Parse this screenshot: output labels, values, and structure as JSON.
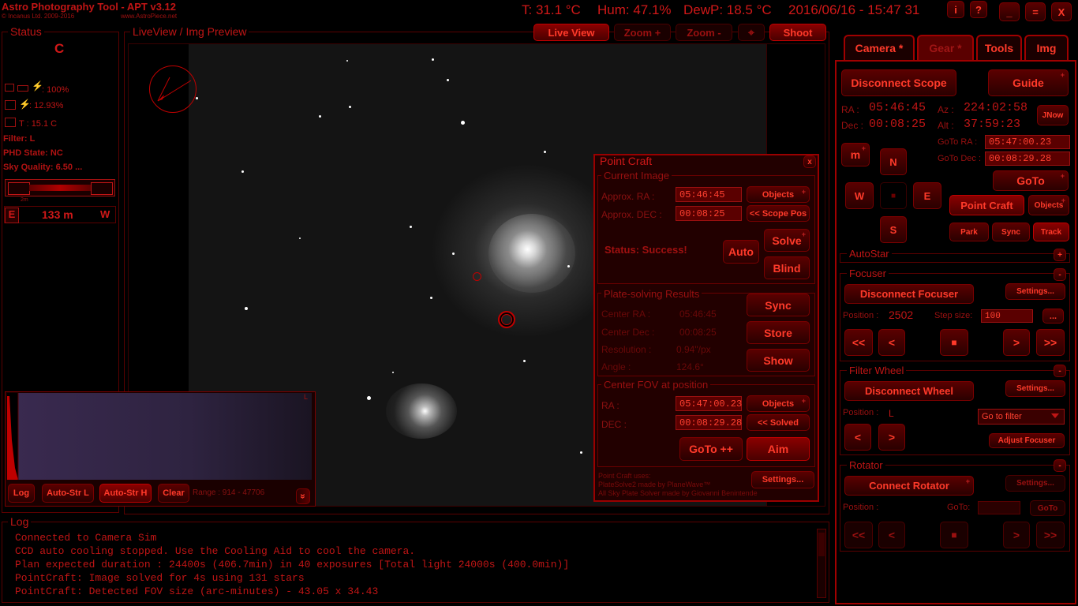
{
  "app": {
    "title": "Astro Photography Tool - APT v3.12",
    "copyright": "© Incanus Ltd. 2009-2016",
    "website": "www.AstroPiece.net"
  },
  "header": {
    "temperature": "T: 31.1 °C",
    "humidity": "Hum: 47.1%",
    "dewpoint": "DewP: 18.5 °C",
    "datetime": "2016/06/16 - 15:47 31",
    "info_label": "i",
    "help_label": "?",
    "minimize_label": "_",
    "maximize_label": "=",
    "close_label": "X"
  },
  "status": {
    "title": "Status",
    "state_letter": "C",
    "power_value": ": 100%",
    "cooler_value": ": 12.93%",
    "temp_value": "T : 15.1 C",
    "filter": "Filter: L",
    "phd_state": "PHD State: NC",
    "sky_quality": "Sky Quality: 6.50 ...",
    "focus_bar_left": "2m",
    "direction_east": "E",
    "distance": "133 m",
    "direction_west": "W"
  },
  "liveview": {
    "title": "LiveView / Img Preview",
    "live_view_btn": "Live View",
    "zoom_in_btn": "Zoom +",
    "zoom_out_btn": "Zoom -",
    "crosshair_btn": "⌖",
    "shoot_btn": "Shoot"
  },
  "histogram": {
    "corner_label": "L",
    "log_btn": "Log",
    "autostr_l_btn": "Auto-Str L",
    "autostr_h_btn": "Auto-Str H",
    "clear_btn": "Clear",
    "range": "Range : 914 - 47706",
    "expand_icon": "»"
  },
  "pointcraft": {
    "title": "Point Craft",
    "close_label": "x",
    "current_image_title": "Current Image",
    "approx_ra_label": "Approx. RA :",
    "approx_ra_value": "05:46:45",
    "approx_dec_label": "Approx. DEC :",
    "approx_dec_value": "00:08:25",
    "objects_btn": "Objects",
    "scope_pos_btn": "<< Scope Pos",
    "status": "Status: Success!",
    "auto_btn": "Auto",
    "solve_btn": "Solve",
    "blind_btn": "Blind",
    "results_title": "Plate-solving Results",
    "center_ra_label": "Center RA :",
    "center_ra_value": "05:46:45",
    "center_dec_label": "Center Dec :",
    "center_dec_value": "00:08:25",
    "resolution_label": "Resolution :",
    "resolution_value": "0.94\"/px",
    "angle_label": "Angle :",
    "angle_value": "124.6°",
    "sync_btn": "Sync",
    "store_btn": "Store",
    "show_btn": "Show",
    "center_fov_title": "Center FOV at position",
    "ra_label": "RA :",
    "ra_value": "05:47:00.23",
    "dec_label": "DEC :",
    "dec_value": "00:08:29.28",
    "objects2_btn": "Objects",
    "solved_btn": "<< Solved",
    "goto_btn": "GoTo ++",
    "aim_btn": "Aim",
    "credits_1": "Point Craft uses:",
    "credits_2": "PlateSolve2 made by PlaneWave™",
    "credits_3": "All Sky Plate Solver made by Giovanni Benintende",
    "settings_btn": "Settings..."
  },
  "log": {
    "title": "Log",
    "lines": [
      "Connected to Camera Sim",
      "CCD auto cooling stopped. Use the Cooling Aid to cool the camera.",
      "Plan expected duration : 24400s (406.7min) in 40 exposures [Total light 24000s (400.0min)]",
      "PointCraft: Image solved for 4s using 131 stars",
      "PointCraft: Detected FOV size (arc-minutes) - 43.05 x 34.43"
    ]
  },
  "tabs": [
    "Camera *",
    "Gear *",
    "Tools",
    "Img"
  ],
  "gear": {
    "disconnect_scope_btn": "Disconnect Scope",
    "guide_btn": "Guide",
    "ra_label": "RA :",
    "ra_value": "05:46:45",
    "dec_label": "Dec :",
    "dec_value": "00:08:25",
    "az_label": "Az :",
    "az_value": "224:02:58",
    "alt_label": "Alt :",
    "alt_value": "37:59:23",
    "jnow_btn": "JNow",
    "goto_ra_label": "GoTo RA :",
    "goto_ra_value": "05:47:00.23",
    "goto_dec_label": "GoTo Dec :",
    "goto_dec_value": "00:08:29.28",
    "m_btn": "m",
    "n_btn": "N",
    "w_btn": "W",
    "stop_btn": "■",
    "e_btn": "E",
    "s_btn": "S",
    "goto_btn": "GoTo",
    "pointcraft_btn": "Point Craft",
    "objects_btn": "Objects",
    "park_btn": "Park",
    "sync_btn": "Sync",
    "track_btn": "Track",
    "autostar_title": "AutoStar",
    "autostar_toggle": "+",
    "focuser_title": "Focuser",
    "focuser_toggle": "-",
    "disconnect_focuser_btn": "Disconnect Focuser",
    "focuser_settings_btn": "Settings...",
    "position_label": "Position :",
    "position_value": "2502",
    "step_label": "Step size:",
    "step_value": "100",
    "step_more_btn": "...",
    "f_fast_left": "<<",
    "f_left": "<",
    "f_stop": "■",
    "f_right": ">",
    "f_fast_right": ">>",
    "filter_title": "Filter Wheel",
    "filter_toggle": "-",
    "disconnect_wheel_btn": "Disconnect Wheel",
    "wheel_settings_btn": "Settings...",
    "wheel_position_label": "Position :",
    "wheel_position_value": "L",
    "goto_filter": "Go to filter",
    "wheel_left": "<",
    "wheel_right": ">",
    "adjust_focuser_btn": "Adjust Focuser",
    "rotator_title": "Rotator",
    "rotator_toggle": "-",
    "connect_rotator_btn": "Connect Rotator",
    "rotator_settings_btn": "Settings...",
    "rot_position_label": "Position :",
    "rot_goto_label": "GoTo:",
    "rot_goto_btn": "GoTo",
    "r_fast_left": "<<",
    "r_left": "<",
    "r_stop": "■",
    "r_right": ">",
    "r_fast_right": ">>"
  }
}
